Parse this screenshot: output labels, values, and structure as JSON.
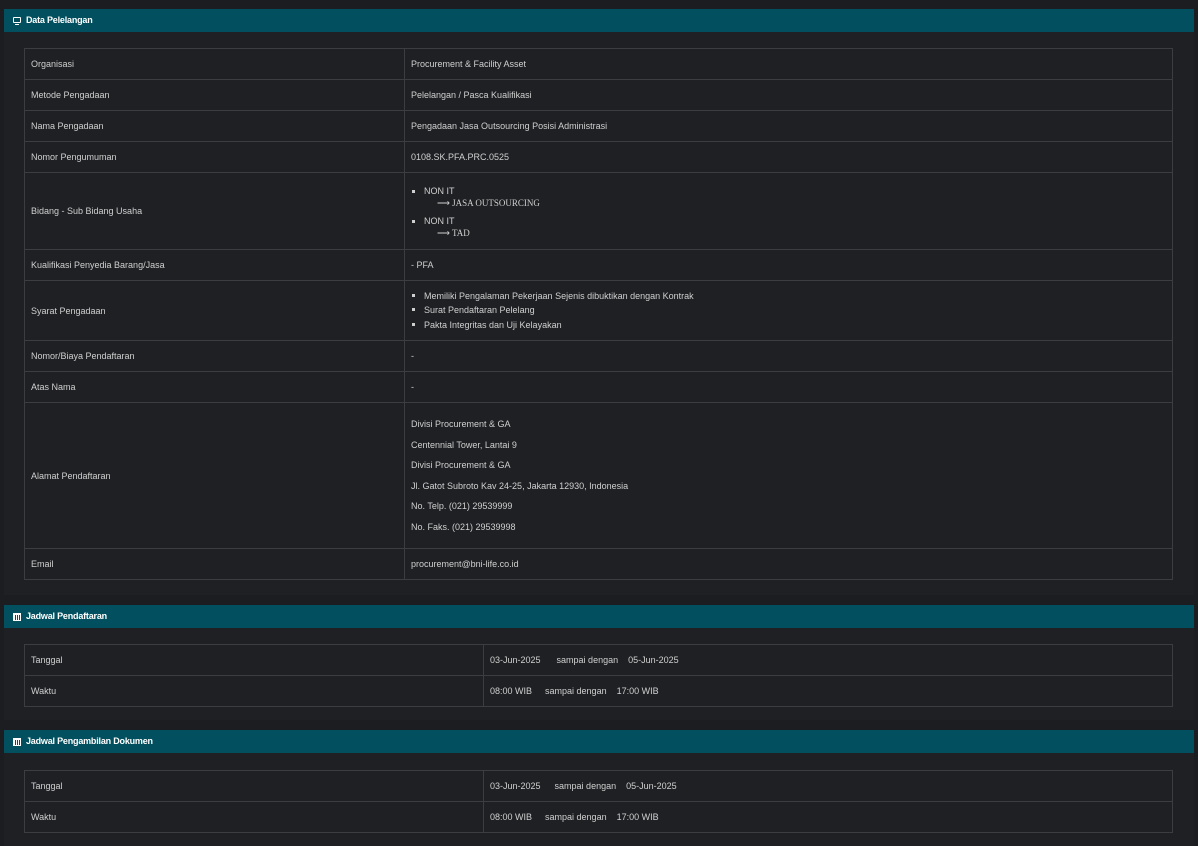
{
  "section1": {
    "title": "Data Pelelangan",
    "rows": {
      "organisasi": {
        "label": "Organisasi",
        "value": "Procurement & Facility Asset"
      },
      "metode": {
        "label": "Metode Pengadaan",
        "value": "Pelelangan / Pasca Kualifikasi"
      },
      "nama": {
        "label": "Nama Pengadaan",
        "value": "Pengadaan Jasa Outsourcing Posisi Administrasi"
      },
      "nomor": {
        "label": "Nomor Pengumuman",
        "value": "0108.SK.PFA.PRC.0525"
      },
      "bidang": {
        "label": "Bidang - Sub Bidang Usaha",
        "items": [
          {
            "main": "NON IT",
            "sub": "⟶ JASA OUTSOURCING"
          },
          {
            "main": "NON IT",
            "sub": "⟶ TAD"
          }
        ]
      },
      "kualifikasi": {
        "label": "Kualifikasi Penyedia Barang/Jasa",
        "value": "- PFA"
      },
      "syarat": {
        "label": "Syarat Pengadaan",
        "items": [
          "Memiliki Pengalaman Pekerjaan Sejenis dibuktikan dengan Kontrak",
          "Surat Pendaftaran Pelelang",
          "Pakta Integritas dan Uji Kelayakan"
        ]
      },
      "biaya": {
        "label": "Nomor/Biaya Pendaftaran",
        "value": "-"
      },
      "atasnama": {
        "label": "Atas Nama",
        "value": "-"
      },
      "alamat": {
        "label": "Alamat Pendaftaran",
        "lines": [
          "Divisi Procurement & GA",
          "Centennial Tower, Lantai 9",
          "Divisi Procurement & GA",
          "Jl. Gatot Subroto Kav 24-25, Jakarta 12930, Indonesia",
          "No. Telp. (021) 29539999",
          "No. Faks. (021) 29539998"
        ]
      },
      "email": {
        "label": "Email",
        "value": "procurement@bni-life.co.id"
      }
    }
  },
  "section2": {
    "title": "Jadwal Pendaftaran",
    "tanggal": {
      "label": "Tanggal",
      "start": "03-Jun-2025",
      "sep": "sampai dengan",
      "end": "05-Jun-2025"
    },
    "waktu": {
      "label": "Waktu",
      "start": "08:00 WIB",
      "sep": "sampai dengan",
      "end": "17:00 WIB"
    }
  },
  "section3": {
    "title": "Jadwal Pengambilan Dokumen",
    "tanggal": {
      "label": "Tanggal",
      "start": "03-Jun-2025",
      "sep": "sampai dengan",
      "end": "05-Jun-2025"
    },
    "waktu": {
      "label": "Waktu",
      "start": "08:00 WIB",
      "sep": "sampai dengan",
      "end": "17:00 WIB"
    }
  }
}
